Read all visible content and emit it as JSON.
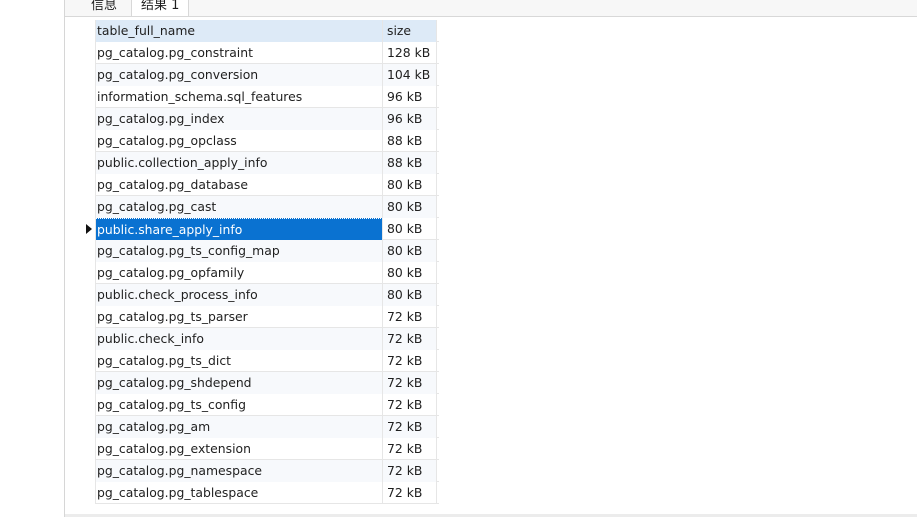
{
  "tabs": [
    {
      "label": "信息"
    },
    {
      "label": "结果 1"
    }
  ],
  "grid": {
    "columns": [
      {
        "label": "table_full_name"
      },
      {
        "label": "size"
      }
    ],
    "rows": [
      {
        "name": "pg_catalog.pg_constraint",
        "size": "128 kB"
      },
      {
        "name": "pg_catalog.pg_conversion",
        "size": "104 kB"
      },
      {
        "name": "information_schema.sql_features",
        "size": "96 kB"
      },
      {
        "name": "pg_catalog.pg_index",
        "size": "96 kB"
      },
      {
        "name": "pg_catalog.pg_opclass",
        "size": "88 kB"
      },
      {
        "name": "public.collection_apply_info",
        "size": "88 kB"
      },
      {
        "name": "pg_catalog.pg_database",
        "size": "80 kB"
      },
      {
        "name": "pg_catalog.pg_cast",
        "size": "80 kB"
      },
      {
        "name": "public.share_apply_info",
        "size": "80 kB"
      },
      {
        "name": "pg_catalog.pg_ts_config_map",
        "size": "80 kB"
      },
      {
        "name": "pg_catalog.pg_opfamily",
        "size": "80 kB"
      },
      {
        "name": "public.check_process_info",
        "size": "80 kB"
      },
      {
        "name": "pg_catalog.pg_ts_parser",
        "size": "72 kB"
      },
      {
        "name": "public.check_info",
        "size": "72 kB"
      },
      {
        "name": "pg_catalog.pg_ts_dict",
        "size": "72 kB"
      },
      {
        "name": "pg_catalog.pg_shdepend",
        "size": "72 kB"
      },
      {
        "name": "pg_catalog.pg_ts_config",
        "size": "72 kB"
      },
      {
        "name": "pg_catalog.pg_am",
        "size": "72 kB"
      },
      {
        "name": "pg_catalog.pg_extension",
        "size": "72 kB"
      },
      {
        "name": "pg_catalog.pg_namespace",
        "size": "72 kB"
      },
      {
        "name": "pg_catalog.pg_tablespace",
        "size": "72 kB"
      }
    ],
    "selected_row_index": 8
  },
  "colors": {
    "header_bg": "#ddeaf7",
    "selection_bg": "#0a72d1",
    "alt_row_bg": "#f7f9fc"
  }
}
